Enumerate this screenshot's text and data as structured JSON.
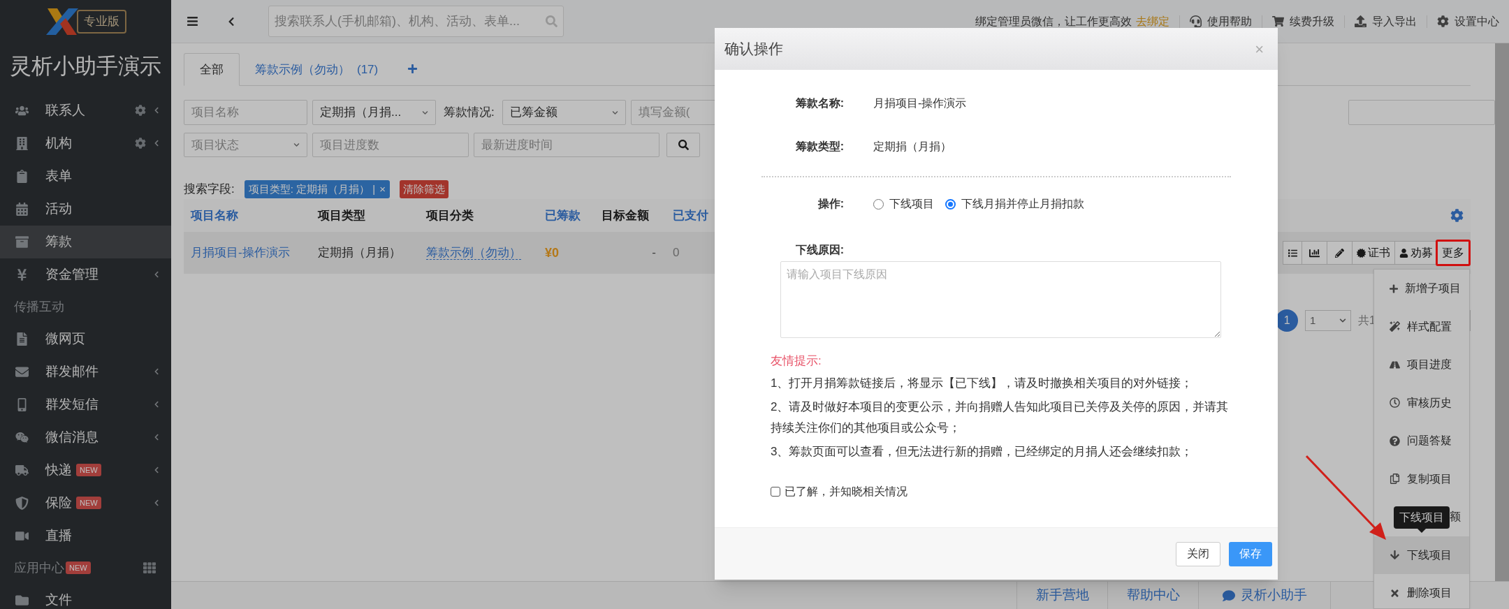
{
  "sidebar": {
    "logo_badge": "专业版",
    "title": "灵析小助手演示",
    "items": [
      {
        "kind": "item",
        "label": "联系人",
        "selected": false,
        "settings": true,
        "expandable": true
      },
      {
        "kind": "item",
        "label": "机构",
        "selected": false,
        "settings": true,
        "expandable": true
      },
      {
        "kind": "item",
        "label": "表单",
        "selected": false,
        "settings": false,
        "expandable": false
      },
      {
        "kind": "item",
        "label": "活动",
        "selected": false,
        "settings": false,
        "expandable": false
      },
      {
        "kind": "item",
        "label": "筹款",
        "selected": true,
        "settings": false,
        "expandable": false
      },
      {
        "kind": "item",
        "label": "资金管理",
        "selected": false,
        "settings": false,
        "expandable": true
      },
      {
        "kind": "section",
        "label": "传播互动"
      },
      {
        "kind": "item",
        "label": "微网页",
        "selected": false,
        "settings": false,
        "expandable": false
      },
      {
        "kind": "item",
        "label": "群发邮件",
        "selected": false,
        "settings": false,
        "expandable": true
      },
      {
        "kind": "item",
        "label": "群发短信",
        "selected": false,
        "settings": false,
        "expandable": true
      },
      {
        "kind": "item",
        "label": "微信消息",
        "selected": false,
        "settings": false,
        "expandable": true
      },
      {
        "kind": "item",
        "label": "快递",
        "badge": "NEW",
        "selected": false,
        "settings": false,
        "expandable": true
      },
      {
        "kind": "item",
        "label": "保险",
        "badge": "NEW",
        "selected": false,
        "settings": false,
        "expandable": true
      },
      {
        "kind": "item",
        "label": "直播",
        "selected": false,
        "settings": false,
        "expandable": false
      },
      {
        "kind": "section",
        "label": "应用中心",
        "badge": "NEW",
        "grid": true
      },
      {
        "kind": "item",
        "label": "文件",
        "selected": false,
        "settings": false,
        "expandable": false
      }
    ]
  },
  "top_bar": {
    "search_placeholder": "搜索联系人(手机邮箱)、机构、活动、表单...",
    "notice": "绑定管理员微信，让工作更高效",
    "notice_link": "去绑定",
    "links": [
      "使用帮助",
      "续费升级",
      "导入导出",
      "设置中心"
    ]
  },
  "tabs": [
    {
      "label": "全部",
      "selected": true
    },
    {
      "label": "筹款示例（勿动）",
      "count": "(17)",
      "selected": false
    }
  ],
  "filters": {
    "row_1": [
      {
        "kind": "input",
        "placeholder": "项目名称"
      },
      {
        "kind": "select",
        "value": "定期捐（月捐..."
      },
      {
        "kind": "label",
        "text": "筹款情况:"
      },
      {
        "kind": "select",
        "value": "已筹金额"
      },
      {
        "kind": "input",
        "placeholder": "填写金额("
      }
    ],
    "row_2": [
      {
        "kind": "select",
        "placeholder": "项目状态"
      },
      {
        "kind": "input",
        "placeholder": "项目进度数"
      },
      {
        "kind": "input",
        "placeholder": "最新进度时间"
      }
    ]
  },
  "search_fields": {
    "label": "搜索字段:",
    "tag": "项目类型: 定期捐（月捐） |",
    "tag_remove": "×",
    "clear": "清除筛选"
  },
  "table": {
    "columns": [
      {
        "label": "项目名称",
        "sortable": true
      },
      {
        "label": "项目类型",
        "sortable": false
      },
      {
        "label": "项目分类",
        "sortable": false
      },
      {
        "label": "已筹款",
        "sortable": true
      },
      {
        "label": "目标金额",
        "sortable": false
      },
      {
        "label": "已支付",
        "sortable": true
      }
    ],
    "rows": [
      {
        "cells": [
          {
            "kind": "link",
            "text": "月捐项目-操作演示"
          },
          {
            "kind": "text",
            "text": "定期捐（月捐）"
          },
          {
            "kind": "category",
            "text": "筹款示例（勿动）"
          },
          {
            "kind": "amount",
            "text": "¥0"
          },
          {
            "kind": "empty",
            "text": "-"
          },
          {
            "kind": "number",
            "text": "0"
          }
        ],
        "actions": [
          {
            "label": "证书",
            "highlighted": false
          },
          {
            "label": "劝募",
            "highlighted": false
          },
          {
            "label": "更多",
            "highlighted": true
          }
        ]
      }
    ]
  },
  "pagination": {
    "current": "1",
    "page_select": "1",
    "total": "共1"
  },
  "more_menu": {
    "items": [
      {
        "kind": "item",
        "label": "新增子项目",
        "selected": false
      },
      {
        "kind": "item",
        "label": "样式配置",
        "selected": false
      },
      {
        "kind": "item",
        "label": "项目进度",
        "selected": false
      },
      {
        "kind": "item",
        "label": "审核历史",
        "selected": false
      },
      {
        "kind": "item",
        "label": "问题答疑",
        "selected": false
      },
      {
        "kind": "item",
        "label": "复制项目",
        "selected": false
      },
      {
        "kind": "covered",
        "label": "额",
        "selected": false
      },
      {
        "kind": "item",
        "label": "下线项目",
        "selected": true
      },
      {
        "kind": "item",
        "label": "删除项目",
        "selected": false
      }
    ],
    "tooltip": "下线项目"
  },
  "bottom_bar": [
    "新手营地",
    "帮助中心",
    "灵析小助手"
  ],
  "modal": {
    "title": "确认操作",
    "close": "×",
    "fields": [
      {
        "label": "筹款名称:",
        "value": "月捐项目-操作演示"
      },
      {
        "label": "筹款类型:",
        "value": "定期捐（月捐）"
      }
    ],
    "operation": {
      "label": "操作:",
      "options": [
        {
          "label": "下线项目",
          "selected": false
        },
        {
          "label": "下线月捐并停止月捐扣款",
          "selected": true
        }
      ]
    },
    "reason": {
      "label": "下线原因:",
      "placeholder": "请输入项目下线原因"
    },
    "tips": {
      "title": "友情提示:",
      "lines": [
        "1、打开月捐筹款链接后，将显示【已下线】，请及时撤换相关项目的对外链接；",
        "2、请及时做好本项目的变更公示，并向捐赠人告知此项目已关停及关停的原因，并请其持续关注你们的其他项目或公众号；",
        "3、筹款页面可以查看，但无法进行新的捐赠，已经绑定的月捐人还会继续扣款；"
      ]
    },
    "acknowledge": {
      "label": "已了解，并知晓相关情况",
      "checked": false
    },
    "buttons": [
      {
        "kind": "default",
        "label": "关闭"
      },
      {
        "kind": "primary",
        "label": "保存"
      }
    ]
  }
}
